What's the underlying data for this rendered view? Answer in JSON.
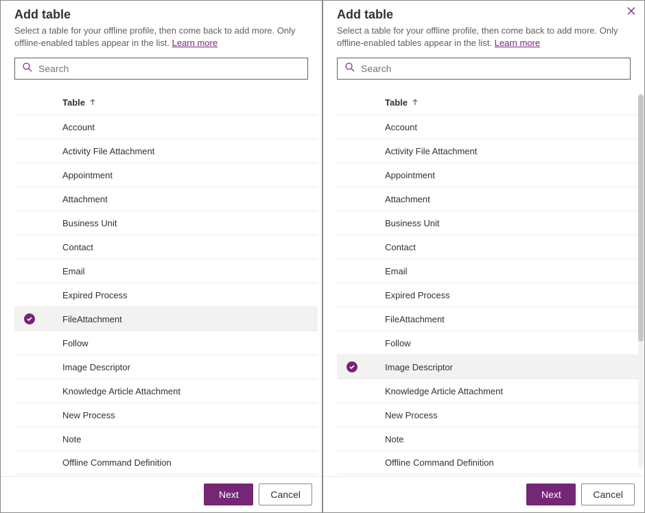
{
  "common": {
    "title": "Add table",
    "description": "Select a table for your offline profile, then come back to add more. Only offline-enabled tables appear in the list. ",
    "learn_more": "Learn more",
    "search_placeholder": "Search",
    "column_header": "Table",
    "next_label": "Next",
    "cancel_label": "Cancel"
  },
  "tables": [
    "Account",
    "Activity File Attachment",
    "Appointment",
    "Attachment",
    "Business Unit",
    "Contact",
    "Email",
    "Expired Process",
    "FileAttachment",
    "Follow",
    "Image Descriptor",
    "Knowledge Article Attachment",
    "New Process",
    "Note",
    "Offline Command Definition"
  ],
  "panels": [
    {
      "show_close": false,
      "selected_index": 8
    },
    {
      "show_close": true,
      "selected_index": 10
    }
  ]
}
